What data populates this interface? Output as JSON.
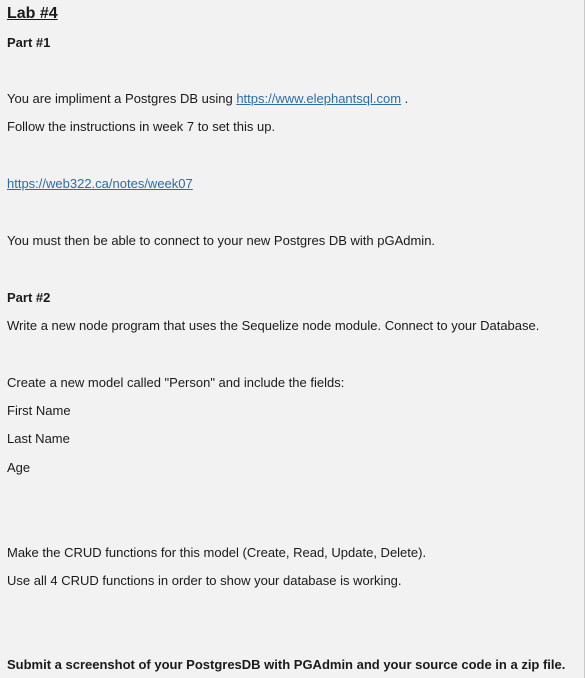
{
  "title": "Lab #4",
  "part1": {
    "heading": "Part #1",
    "intro_prefix": "You are impliment a Postgres DB using ",
    "intro_link": "https://www.elephantsql.com",
    "intro_suffix": " .",
    "follow": "Follow the instructions in week 7 to set this up.",
    "notes_link": "https://web322.ca/notes/week07",
    "connect": "You must then be able to connect to your new Postgres DB with pGAdmin."
  },
  "part2": {
    "heading": "Part #2",
    "write": "Write a new node program that uses the Sequelize node module. Connect to your Database.",
    "create_model": "Create a new model called \"Person\" and include the fields:",
    "fields": [
      "First Name",
      "Last Name",
      "Age"
    ],
    "crud": "Make the CRUD functions for this model (Create, Read, Update, Delete).",
    "use_all": "Use all 4 CRUD functions in order to show your database is working.",
    "submit": "Submit a screenshot of your PostgresDB with PGAdmin and your source code in a zip file."
  }
}
